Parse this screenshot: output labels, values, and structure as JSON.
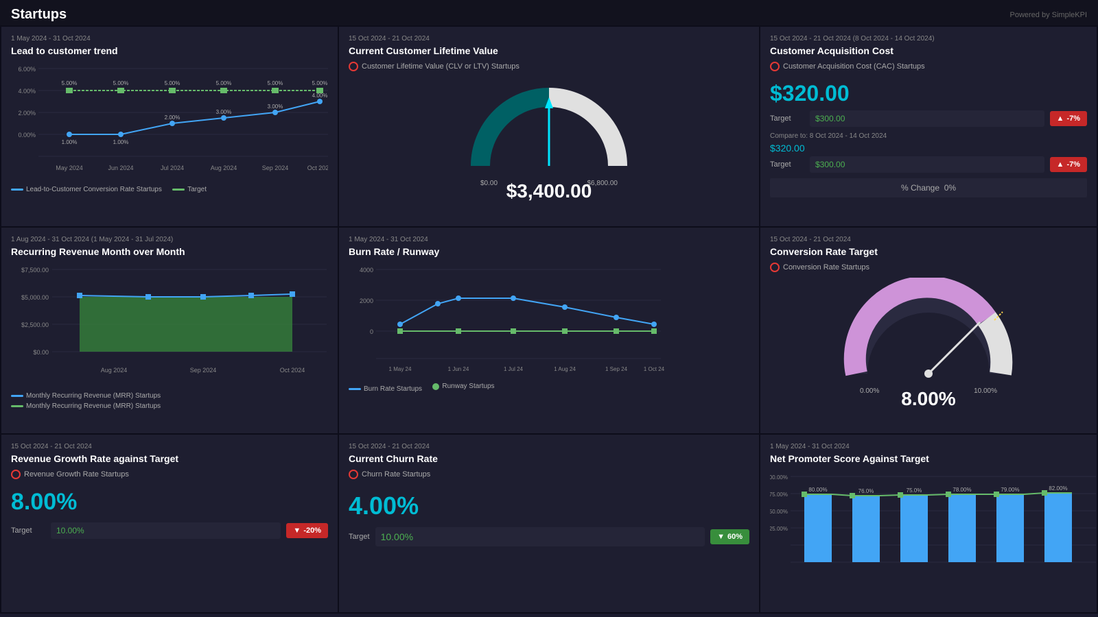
{
  "header": {
    "title": "Startups",
    "powered_by": "Powered by SimpleKPI"
  },
  "cards": {
    "lead_trend": {
      "date": "1 May 2024 - 31 Oct 2024",
      "title": "Lead to customer trend",
      "legend": [
        {
          "label": "Lead-to-Customer Conversion Rate Startups",
          "color": "#42a5f5"
        },
        {
          "label": "Target",
          "color": "#66bb6a"
        }
      ]
    },
    "recurring_revenue": {
      "date": "1 Aug 2024 - 31 Oct 2024  (1 May 2024 - 31 Jul 2024)",
      "title": "Recurring Revenue Month over Month",
      "legend": [
        {
          "label": "Monthly Recurring Revenue (MRR) Startups",
          "color": "#42a5f5"
        },
        {
          "label": "Monthly Recurring Revenue (MRR) Startups",
          "color": "#66bb6a"
        }
      ]
    },
    "revenue_growth": {
      "date": "15 Oct 2024 - 21 Oct 2024",
      "title": "Revenue Growth Rate against Target",
      "datasource": "Revenue Growth Rate Startups",
      "value": "8.00%",
      "target_label": "Target",
      "target_value": "10.00%",
      "badge": "-20%",
      "badge_type": "red"
    },
    "clv": {
      "date": "15 Oct 2024 - 21 Oct 2024",
      "title": "Current Customer Lifetime Value",
      "datasource": "Customer Lifetime Value (CLV or LTV) Startups",
      "gauge_min": "$0.00",
      "gauge_max": "$6,800.00",
      "gauge_value": "$3,400.00"
    },
    "burn_rate": {
      "date": "1 May 2024 - 31 Oct 2024",
      "title": "Burn Rate / Runway",
      "legend": [
        {
          "label": "Burn Rate Startups",
          "color": "#42a5f5"
        },
        {
          "label": "Runway Startups",
          "color": "#66bb6a"
        }
      ]
    },
    "churn_rate": {
      "date": "15 Oct 2024 - 21 Oct 2024",
      "title": "Current Churn Rate",
      "datasource": "Churn Rate Startups",
      "value": "4.00%",
      "target_label": "Target",
      "target_value": "10.00%",
      "badge": "60%",
      "badge_type": "green"
    },
    "cac": {
      "date": "15 Oct 2024 - 21 Oct 2024  (8 Oct 2024 - 14 Oct 2024)",
      "title": "Customer Acquisition Cost",
      "datasource": "Customer Acquisition Cost (CAC) Startups",
      "value": "$320.00",
      "target_label": "Target",
      "target_value": "$300.00",
      "badge": "-7%",
      "badge_type": "red",
      "compare_date": "Compare to:  8 Oct 2024 - 14 Oct 2024",
      "compare_value": "$320.00",
      "compare_target": "$300.00",
      "compare_badge": "-7%",
      "pct_change_label": "% Change",
      "pct_change_value": "0%"
    },
    "conversion_rate": {
      "date": "15 Oct 2024 - 21 Oct 2024",
      "title": "Conversion Rate Target",
      "datasource": "Conversion Rate Startups",
      "gauge_min": "0.00%",
      "gauge_max": "10.00%",
      "gauge_value": "8.00%"
    },
    "nps": {
      "date": "1 May 2024 - 31 Oct 2024",
      "title": "Net Promoter Score Against Target"
    }
  }
}
